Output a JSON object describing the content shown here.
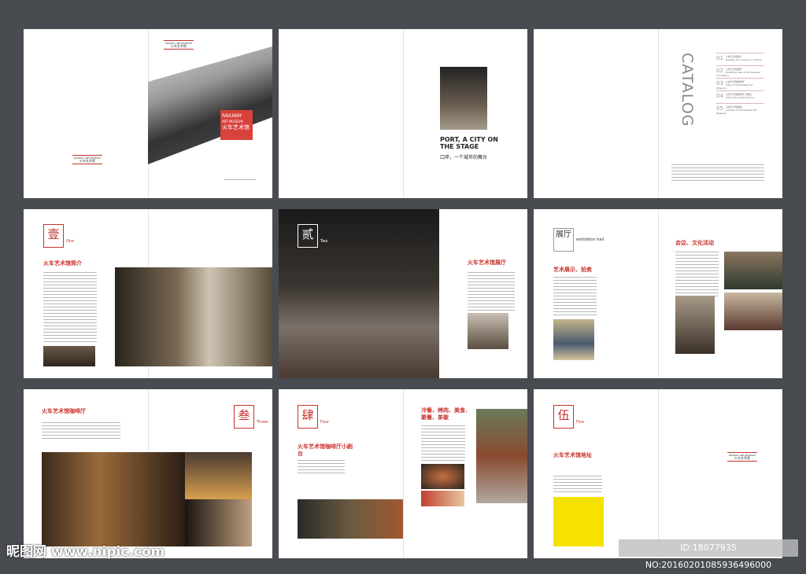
{
  "cover": {
    "logo_en": "RAILWAY ART MUSEUM",
    "logo_cn": "火车艺术馆",
    "badge_line1": "RAILWAY",
    "badge_line2": "ART MUSEUM",
    "badge_cn": "火车艺术馆"
  },
  "intro": {
    "title_en": "PORT, A CITY ON THE STAGE",
    "title_cn": "口岸，一个城市的舞台"
  },
  "catalog": {
    "title": "CATALOG",
    "items": [
      {
        "num": "01",
        "cn": "火车艺术馆简介",
        "en": "Railway art museum in outline"
      },
      {
        "num": "02",
        "cn": "火车艺术馆展厅",
        "en": "Exhibition hall of the Railway Art Gallery"
      },
      {
        "num": "03",
        "cn": "火车艺术馆咖啡厅",
        "en": "Cafe of the Railway Art Museum"
      },
      {
        "num": "04",
        "cn": "火车艺术馆咖啡厅小剧台",
        "en": "Cafe Cafe small balcony"
      },
      {
        "num": "05",
        "cn": "火车艺术馆地址",
        "en": "Address of the Railway Art Museum"
      }
    ]
  },
  "sections": [
    {
      "numeral": "壹",
      "en": "One",
      "title": "火车艺术馆简介"
    },
    {
      "numeral": "贰",
      "en": "Two",
      "title": "火车艺术馆展厅"
    },
    {
      "numeral": "展厅",
      "en": "exhibition hall",
      "title": "艺术展示、拍卖",
      "title2": "会议、文化活动"
    },
    {
      "numeral": "叁",
      "en": "Three",
      "title": "火车艺术馆咖啡厅"
    },
    {
      "numeral": "肆",
      "en": "Four",
      "title": "火车艺术馆咖啡厅小剧台",
      "title2": "冷餐、烤肉、美食、聚餐、茶歇"
    },
    {
      "numeral": "伍",
      "en": "Five",
      "title": "火车艺术馆地址"
    }
  ],
  "watermark": {
    "site": "昵图网 www.nipic.com",
    "id": "ID:18077935 NO:20160201085936496000"
  },
  "colors": {
    "accent": "#c8322d",
    "background": "#484b50"
  }
}
